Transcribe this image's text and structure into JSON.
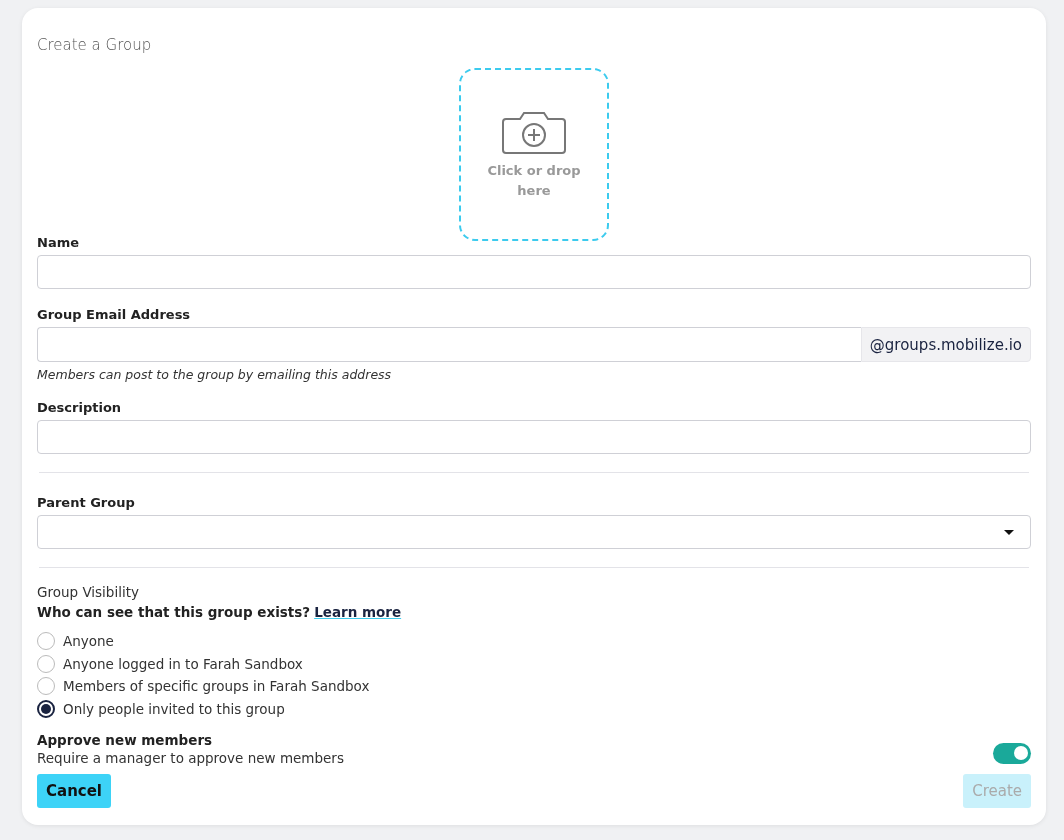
{
  "title": "Create a Group",
  "upload": {
    "label": "Click or drop here"
  },
  "name_field": {
    "label": "Name"
  },
  "email_field": {
    "label": "Group Email Address",
    "suffix": "@groups.mobilize.io",
    "hint": "Members can post to the group by emailing this address"
  },
  "description_field": {
    "label": "Description"
  },
  "parent_group": {
    "label": "Parent Group"
  },
  "visibility": {
    "heading": "Group Visibility",
    "question": "Who can see that this group exists?",
    "link": "Learn more",
    "options": [
      {
        "label": "Anyone",
        "selected": false
      },
      {
        "label": "Anyone logged in to Farah Sandbox",
        "selected": false
      },
      {
        "label": "Members of specific groups in Farah Sandbox",
        "selected": false
      },
      {
        "label": "Only people invited to this group",
        "selected": true
      }
    ]
  },
  "approve": {
    "title": "Approve new members",
    "description": "Require a manager to approve new members",
    "on": true
  },
  "buttons": [
    {
      "label": "Cancel",
      "disabled": false
    },
    {
      "label": "Create",
      "disabled": true
    }
  ]
}
